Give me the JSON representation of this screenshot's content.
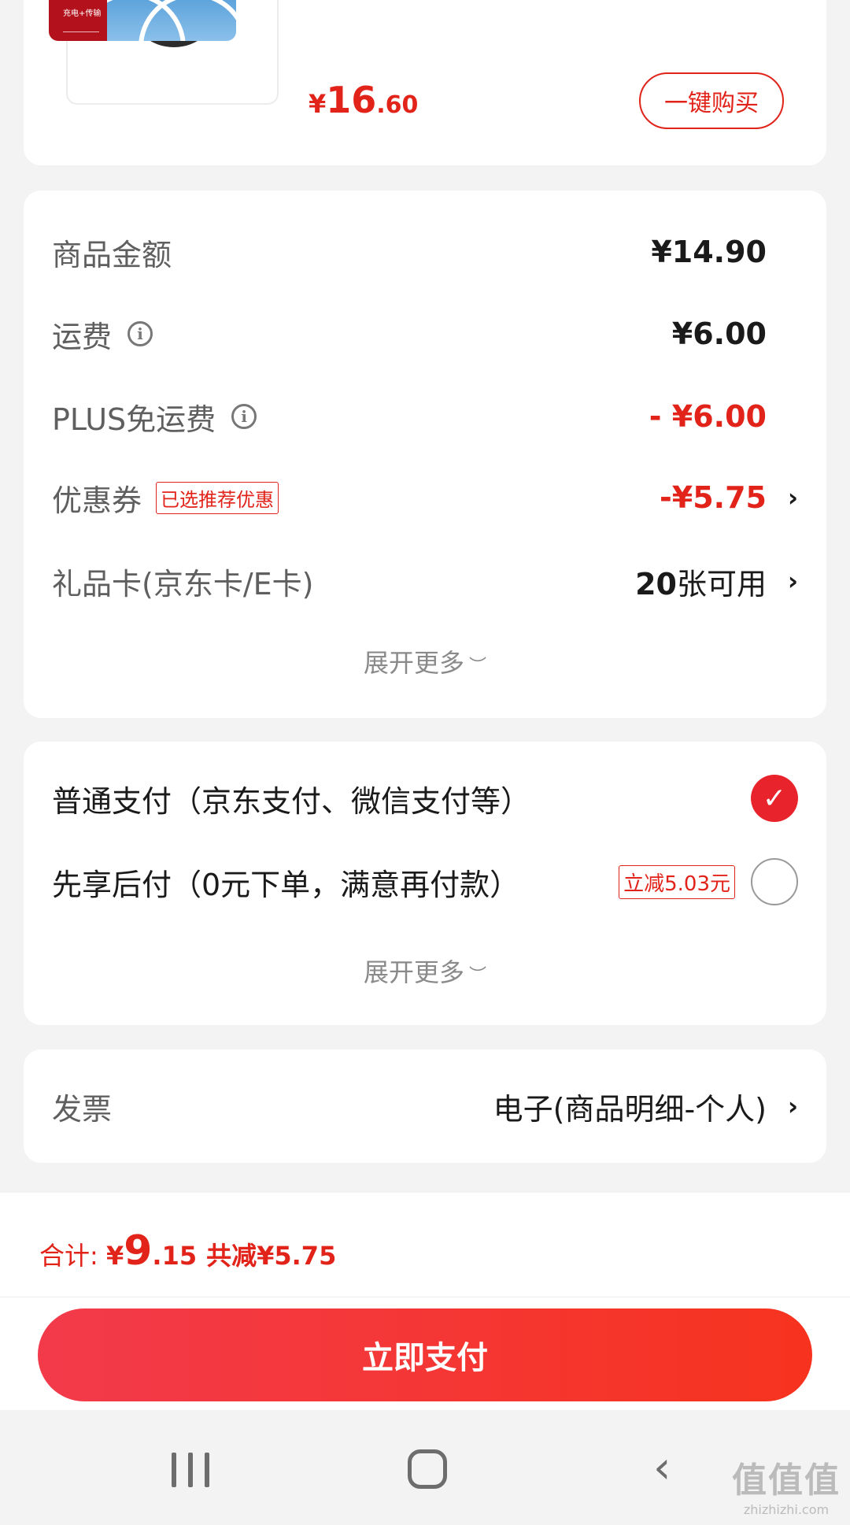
{
  "product": {
    "thumb_text": "充电+传输",
    "price_currency": "¥",
    "price_int": "16",
    "price_dec": ".60",
    "buy_button": "一键购买"
  },
  "amounts": {
    "goods_label": "商品金额",
    "goods_value": "¥14.90",
    "shipping_label": "运费",
    "shipping_value": "¥6.00",
    "plus_label": "PLUS免运费",
    "plus_value": "- ¥6.00",
    "coupon_label": "优惠券",
    "coupon_tag": "已选推荐优惠",
    "coupon_value": "-¥5.75",
    "giftcard_label": "礼品卡(京东卡/E卡)",
    "giftcard_count": "20",
    "giftcard_unit": "张可用",
    "expand_more": "展开更多"
  },
  "payment": {
    "normal_label": "普通支付（京东支付、微信支付等）",
    "later_label": "先享后付（0元下单，满意再付款）",
    "later_tag": "立减5.03元",
    "expand_more": "展开更多"
  },
  "invoice": {
    "label": "发票",
    "value": "电子(商品明细-个人)"
  },
  "footer": {
    "total_label": "合计: ",
    "total_currency": "¥",
    "total_int": "9",
    "total_dec": ".15",
    "discount": "共减¥5.75",
    "pay_button": "立即支付"
  },
  "watermark": {
    "big": "值值值",
    "small": "zhizhizhi.com"
  },
  "colors": {
    "accent_red": "#e2231a",
    "button_gradient_start": "#f23a4b",
    "button_gradient_end": "#f7331f"
  },
  "icons": [
    "info-icon",
    "chevron-right-icon",
    "chevron-down-icon",
    "check-icon",
    "nav-recents-icon",
    "nav-home-icon",
    "nav-back-icon"
  ]
}
